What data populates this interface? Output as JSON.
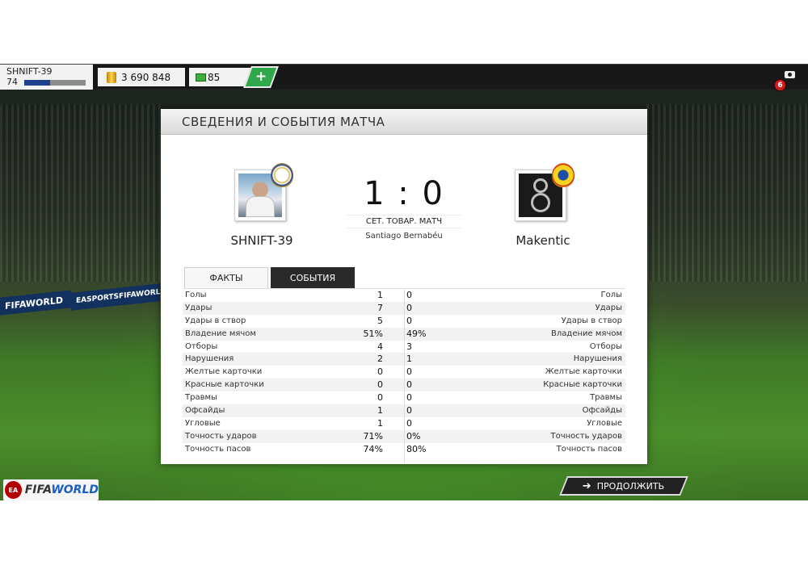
{
  "topbar": {
    "player_name": "SHNIFT-39",
    "player_level": "74",
    "xp_progress": 0.42,
    "coins": "3 690 848",
    "fifa_points": "85",
    "add_label": "+",
    "notifications": "6"
  },
  "background": {
    "adboard_1": "FIFAWORLD",
    "adboard_2": "EASPORTSFIFAWORLD"
  },
  "panel": {
    "title": "СВЕДЕНИЯ И СОБЫТИЯ МАТЧА",
    "home_team": "SHNIFT-39",
    "away_team": "Makentic",
    "score": "1 : 0",
    "match_type": "СЕТ. ТОВАР. МАТЧ",
    "stadium": "Santiago Bernabéu",
    "tabs": {
      "facts": "ФАКТЫ",
      "events": "СОБЫТИЯ"
    },
    "stats": [
      {
        "label": "Голы",
        "home": "1",
        "away": "0"
      },
      {
        "label": "Удары",
        "home": "7",
        "away": "0"
      },
      {
        "label": "Удары в створ",
        "home": "5",
        "away": "0"
      },
      {
        "label": "Владение мячом",
        "home": "51%",
        "away": "49%"
      },
      {
        "label": "Отборы",
        "home": "4",
        "away": "3"
      },
      {
        "label": "Нарушения",
        "home": "2",
        "away": "1"
      },
      {
        "label": "Желтые карточки",
        "home": "0",
        "away": "0"
      },
      {
        "label": "Красные карточки",
        "home": "0",
        "away": "0"
      },
      {
        "label": "Травмы",
        "home": "0",
        "away": "0"
      },
      {
        "label": "Офсайды",
        "home": "1",
        "away": "0"
      },
      {
        "label": "Угловые",
        "home": "1",
        "away": "0"
      },
      {
        "label": "Точность ударов",
        "home": "71%",
        "away": "0%"
      },
      {
        "label": "Точность пасов",
        "home": "74%",
        "away": "80%"
      }
    ]
  },
  "footer": {
    "ea_label": "EA",
    "logo_text_a": "FIFA",
    "logo_text_b": "WORLD",
    "continue_label": "ПРОДОЛЖИТЬ"
  },
  "colors": {
    "accent_green": "#2ea84a",
    "badge_red": "#d01c1c",
    "xp_blue": "#1f3f8f"
  }
}
